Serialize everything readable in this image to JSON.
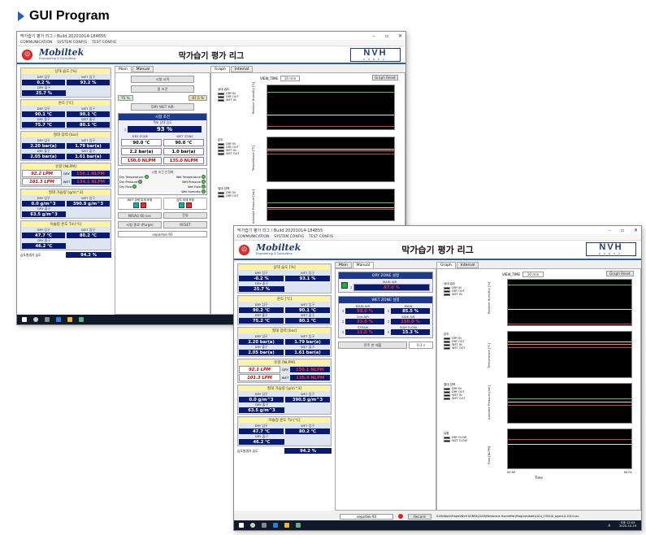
{
  "slide": {
    "title": "GUI Program"
  },
  "app": {
    "window_title": "막가습기 평가 리그 / Build 20201014-184855",
    "menu": [
      "COMMUNICATION",
      "SYSTEM CONFIG",
      "TEST CONFIG"
    ],
    "title": "막가습기 평가 리그",
    "logo": "Mobiltek",
    "logo_sub": "Engineering & Consulting",
    "nvh_brand": "NVH",
    "nvh_sub": "KOREA"
  },
  "left_panel": {
    "humidity": {
      "header": "상대 습도 [%]",
      "dry_in_label": "DRY 입구",
      "wet_in_label": "WET 입구",
      "dry_out_label": "DRY 출구",
      "dry_in_w1": "0.2 %",
      "wet_in_w1": "93.2 %",
      "dry_out_w1": "25.7 %",
      "dry_in_w2": "-0.2 %",
      "wet_in_w2": "93.1 %",
      "dry_out_w2": "25.7 %"
    },
    "temperature": {
      "header": "온도 [℃]",
      "dry_in_label": "DRY 입구",
      "wet_in_label": "WET 입구",
      "dry_out_label": "DRY 출구",
      "wet_out_label": "WET 출구",
      "w1": [
        "90.1 ℃",
        "90.1 ℃",
        "75.7 ℃",
        "80.1 ℃"
      ],
      "w2": [
        "90.2 ℃",
        "90.1 ℃",
        "75.2 ℃",
        "80.1 ℃"
      ]
    },
    "pressure": {
      "header": "절대 압력 [bar]",
      "dry_in_label": "DRY 입구",
      "wet_in_label": "WET 입구",
      "dry_out_label": "DRY 출구",
      "wet_out_label": "WET 출구",
      "w1": [
        "2.20 bar(a)",
        "1.79 bar(a)",
        "2.05 bar(a)",
        "1.61 bar(a)"
      ],
      "w2": [
        "2.20 bar(a)",
        "1.79 bar(a)",
        "2.05 bar(a)",
        "1.61 bar(a)"
      ]
    },
    "flow": {
      "header": "유량 [NLPM]",
      "dry_label": "DRY",
      "wet_label": "WET",
      "w1": [
        "92.2 LPM",
        "150.1 NLPM",
        "101.3 LPM",
        "134.1 NLPM"
      ],
      "w2": [
        "92.1 LPM",
        "150.1 NLPM",
        "101.3 LPM",
        "135.0 NLPM"
      ]
    },
    "humid_amount": {
      "header": "절대 가습량 [g/m^3]",
      "dry_in_label": "DRY 입구",
      "wet_in_label": "WET 입구",
      "dry_out_label": "DRY 출구",
      "w1": [
        "0.0 g/m^3",
        "390.9 g/m^3",
        "63.5 g/m^3"
      ],
      "w2": [
        "0.0 g/m^3",
        "390.5 g/m^3",
        "63.5 g/m^3"
      ]
    },
    "dewpoint": {
      "header": "이슬점 온도 Td [℃]",
      "dry_in_label": "DRY 입구",
      "wet_in_label": "WET 입구",
      "dry_out_label": "DRY 출구",
      "w1": [
        "47.7 ℃",
        "80.2 ℃",
        "46.2 ℃"
      ],
      "w2": [
        "47.7 ℃",
        "80.2 ℃",
        "46.2 ℃"
      ]
    },
    "eff": {
      "label": "습도발생기 습도",
      "w1": "94.2 %",
      "w2": "94.2 %"
    }
  },
  "main_tabs": [
    "Main",
    "Manual"
  ],
  "w1_main": {
    "btn1": "시험 시작",
    "btn2": "중 조건",
    "pct1": "75 %",
    "pct2": "87.5 %",
    "btn3": "DRY WET AIR",
    "cond_header": "시험 조건",
    "target_label": "목표 상대 습도",
    "target_val": "93 %",
    "dry_zone": "DRY ZONE",
    "wet_zone": "WET ZONE",
    "temp": [
      "90.0 ℃",
      "90.0 ℃"
    ],
    "press": [
      "2.2 bar(a)",
      "1.0 bar(a)"
    ],
    "flow": [
      "150.0 NLPM",
      "135.0 NLPM"
    ],
    "state_header": "시험 조건 안정화",
    "states": [
      "Dry Temperature",
      "Wet Temperature",
      "Dry Pressure",
      "Wet Pressure",
      "Dry Flow",
      "Wet Flow",
      "Wet Humidity"
    ],
    "valve_label1": "WET 유량 미세 조정",
    "valve_label2": "습도 미세 조정",
    "nisag": "NISAG 60 sec",
    "apply": "전송",
    "purge": "시험 종료 (Purge)",
    "reset": "RESET",
    "user": "separtek-93"
  },
  "w2_manual": {
    "dry_zone_hdr": "DRY ZONE 설정",
    "main_air": "MAIN AIR",
    "main_air_val": "87.0 %",
    "wet_zone_hdr": "WET ZONE 설정",
    "labels": [
      "MAIN AIR",
      "MAIN",
      "2nd AIR",
      "SIDE AIR",
      "STEAM",
      "SIDE FLOW"
    ],
    "vals": [
      "88.0 %",
      "85.5 %",
      "33.0 %",
      "150.0 %",
      "11.0 %",
      "15.3 %"
    ],
    "btn": "전주 한 제출",
    "btn_val": "0.1 s",
    "user": "separtek-93",
    "record": "Record",
    "path": "D:\\MyWork\\Project\\NVH KOREA\\2020\\Membrane Humidifier\\Program\\data\\1014_135510_opwr4.0-1014.csv"
  },
  "graph": {
    "tabs": [
      "Graph",
      "Internal"
    ],
    "view_label": "VIEW_TIME",
    "view_val": "10 min",
    "reset": "Graph Reset",
    "g1": {
      "title": "상대 습도",
      "series": [
        "DRY IN",
        "DRY OUT",
        "WET IN"
      ],
      "ylabel": "Relative Humidity [%]",
      "ticks": [
        "120",
        "100",
        "80",
        "60",
        "40",
        "20",
        "0"
      ]
    },
    "g2": {
      "title": "온도",
      "series": [
        "DRY IN",
        "DRY OUT",
        "WET IN",
        "WET OUT"
      ],
      "ylabel": "Temperature [℃]",
      "ticks": [
        "120",
        "100",
        "80",
        "60",
        "40",
        "20",
        "0"
      ]
    },
    "g3": {
      "title": "절대 압력",
      "series": [
        "DRY IN",
        "DRY OUT",
        "WET IN",
        "WET OUT"
      ],
      "ylabel": "Absolute Pressure [bar]",
      "ticks": [
        "4",
        "3",
        "2",
        "1",
        "0"
      ]
    },
    "g4": {
      "title": "유량",
      "series": [
        "DRY FLOW",
        "WET FLOW"
      ],
      "ylabel": "Flow [NLPM]",
      "ticks": [
        "200",
        "150",
        "100",
        "50",
        "0"
      ]
    },
    "xlabel": "Time",
    "xticks": [
      "00.00",
      "00.01"
    ]
  },
  "w2_taskbar_time": "오후 12:04",
  "w2_taskbar_date": "2020-10-19",
  "lang": "A"
}
